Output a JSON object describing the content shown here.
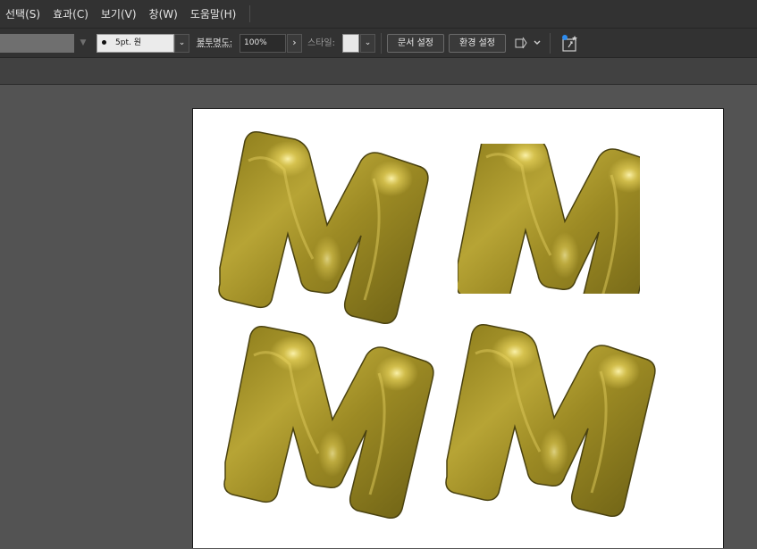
{
  "menubar": {
    "items": [
      "선택(S)",
      "효과(C)",
      "보기(V)",
      "창(W)",
      "도움말(H)"
    ]
  },
  "controlbar": {
    "stroke_profile": "5pt. 원",
    "opacity_label": "불투명도:",
    "opacity_value": "100%",
    "style_label": "스타일:",
    "document_setup_label": "문서 설정",
    "preferences_label": "환경 설정"
  },
  "icons": {
    "dropdown": "chevron-down-icon",
    "arrow": "chevron-right-icon",
    "arrange": "arrange-documents-icon",
    "puppet_warp": "puppet-warp-icon"
  },
  "artwork": {
    "description_letters": [
      "M",
      "M",
      "M",
      "M"
    ],
    "fill_color": "#a8962a",
    "highlight_color": "#f3e27a",
    "shadow_color": "#5e5412"
  }
}
